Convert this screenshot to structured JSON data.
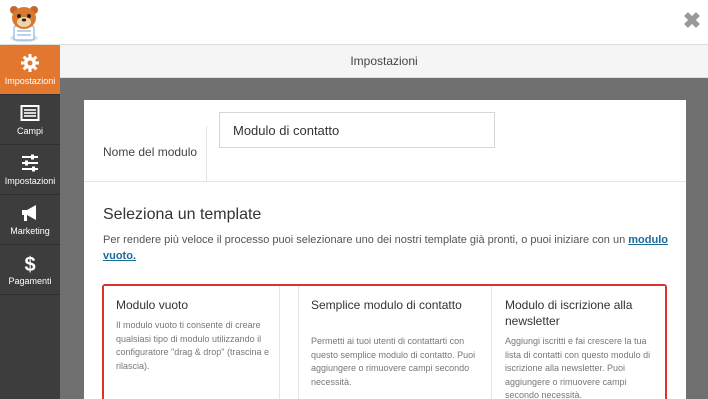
{
  "close": "✖",
  "header": {
    "title": "Impostazioni"
  },
  "sidebar": {
    "items": [
      {
        "label": "Impostazioni",
        "icon": "gear-icon"
      },
      {
        "label": "Campi",
        "icon": "fields-list-icon"
      },
      {
        "label": "Impostazioni",
        "icon": "sliders-icon"
      },
      {
        "label": "Marketing",
        "icon": "megaphone-icon"
      },
      {
        "label": "Pagamenti",
        "icon": "dollar-icon"
      }
    ]
  },
  "form": {
    "name_label": "Nome del modulo",
    "name_value": "Modulo di contatto"
  },
  "template_section": {
    "title": "Seleziona un template",
    "desc": "Per rendere più veloce il processo puoi selezionare uno dei nostri template già pronti, o puoi iniziare con un ",
    "link": "modulo vuoto."
  },
  "templates": [
    {
      "title": "Modulo vuoto",
      "desc": "Il modulo vuoto ti consente di creare qualsiasi tipo di modulo utilizzando il configuratore \"drag & drop\" (trascina e rilascia)."
    },
    {
      "title": "Semplice modulo di contatto",
      "desc": "Permetti ai tuoi utenti di contattarti con questo semplice modulo di contatto. Puoi aggiungere o rimuovere campi secondo necessità."
    },
    {
      "title": "Modulo di iscrizione alla newsletter",
      "desc": "Aggiungi iscritti e fai crescere la tua lista di contatti con questo modulo di iscrizione alla newsletter. Puoi aggiungere o rimuovere campi secondo necessità."
    }
  ],
  "colors": {
    "accent": "#e27730",
    "sidebar": "#3d3d3d",
    "highlight": "#d9342b",
    "link": "#1a6a9a"
  }
}
